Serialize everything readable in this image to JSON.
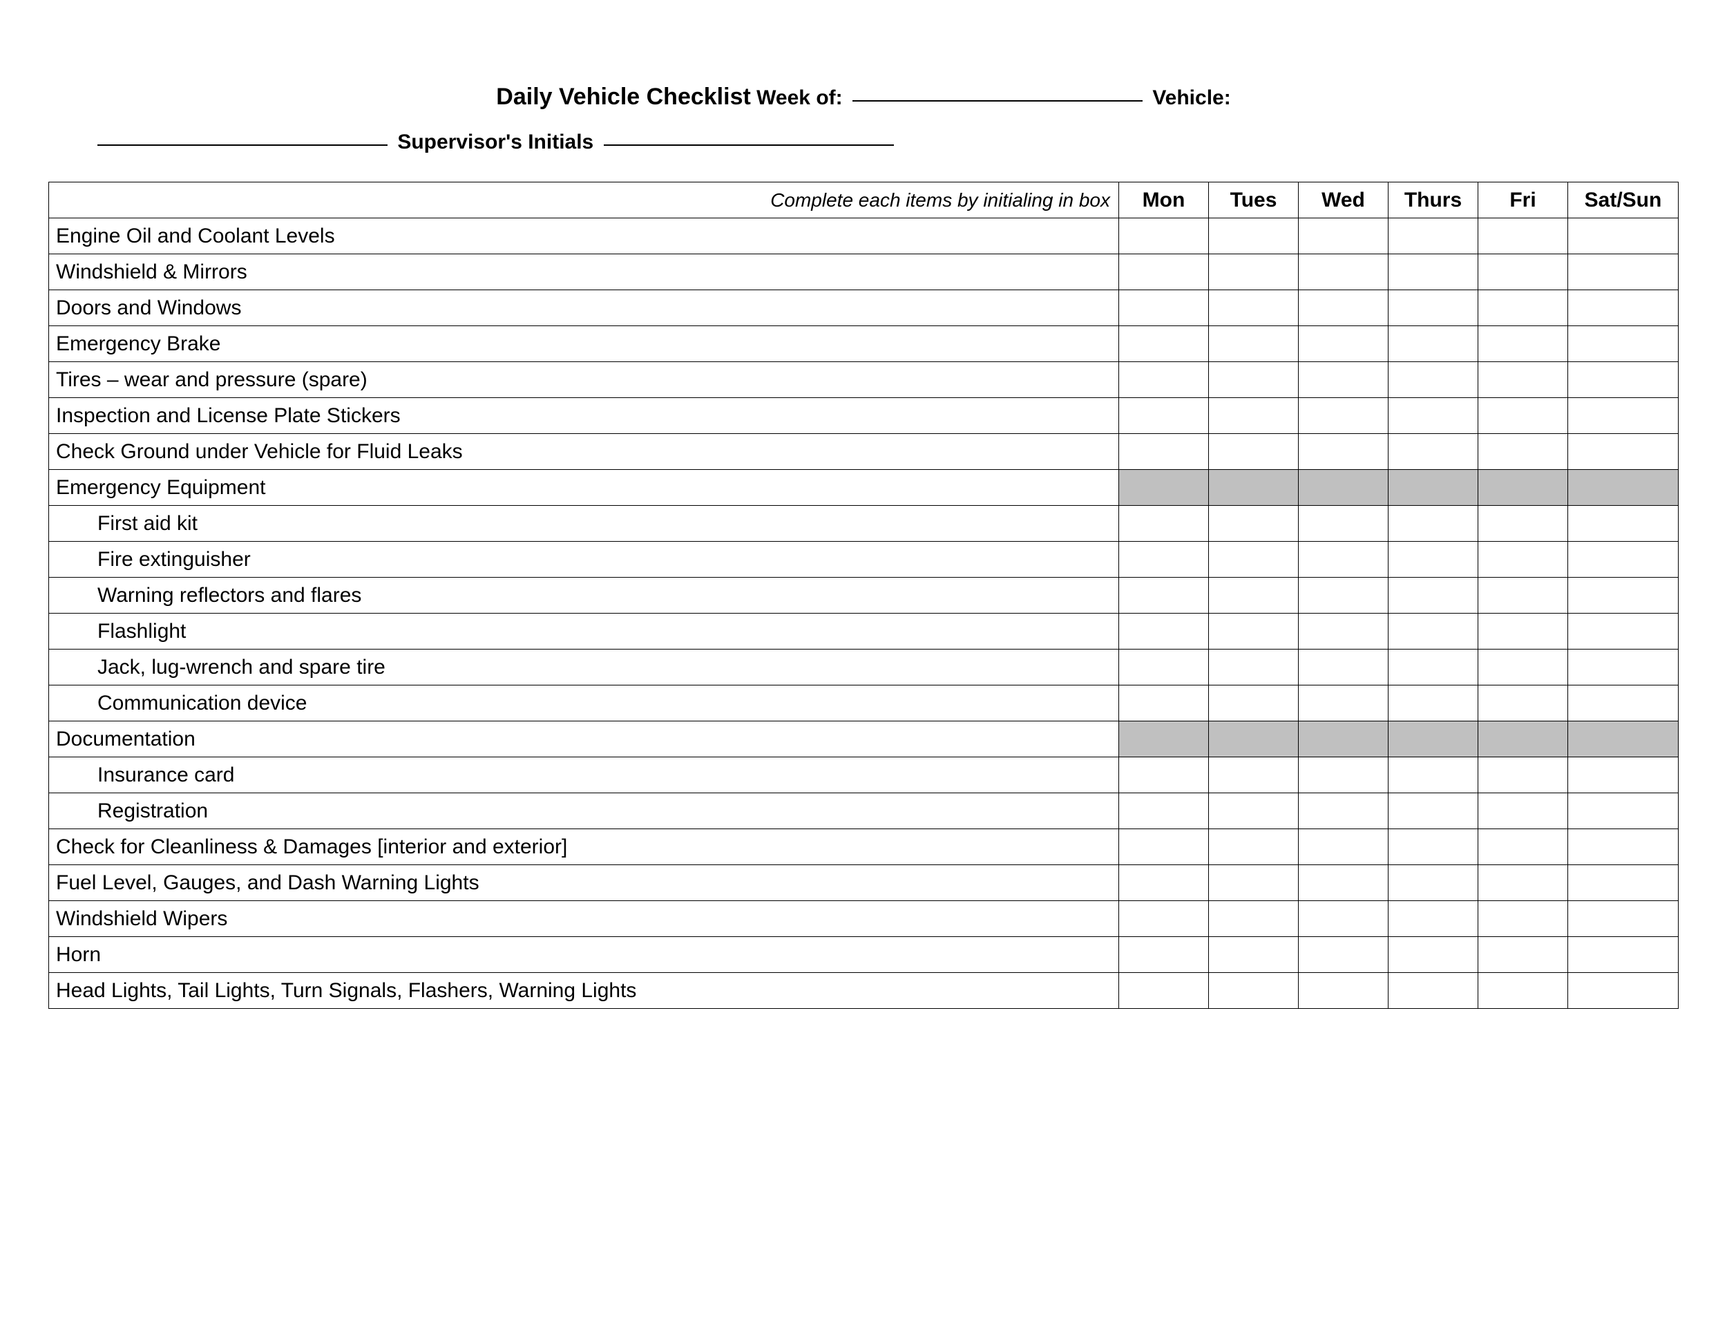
{
  "header": {
    "title": "Daily Vehicle Checklist",
    "week_of_label": "Week of:",
    "vehicle_label": "Vehicle:",
    "supervisor_label": "Supervisor's Initials"
  },
  "table": {
    "instruction": "Complete each items by initialing in box",
    "days": [
      "Mon",
      "Tues",
      "Wed",
      "Thurs",
      "Fri",
      "Sat/Sun"
    ],
    "rows": [
      {
        "label": "Engine Oil and Coolant Levels",
        "indent": false,
        "shaded": false
      },
      {
        "label": "Windshield & Mirrors",
        "indent": false,
        "shaded": false
      },
      {
        "label": "Doors and Windows",
        "indent": false,
        "shaded": false
      },
      {
        "label": "Emergency Brake",
        "indent": false,
        "shaded": false
      },
      {
        "label": "Tires – wear and pressure (spare)",
        "indent": false,
        "shaded": false
      },
      {
        "label": "Inspection and License Plate Stickers",
        "indent": false,
        "shaded": false
      },
      {
        "label": "Check Ground under Vehicle for Fluid Leaks",
        "indent": false,
        "shaded": false
      },
      {
        "label": "Emergency Equipment",
        "indent": false,
        "shaded": true
      },
      {
        "label": "First aid kit",
        "indent": true,
        "shaded": false
      },
      {
        "label": "Fire extinguisher",
        "indent": true,
        "shaded": false
      },
      {
        "label": "Warning reflectors and flares",
        "indent": true,
        "shaded": false
      },
      {
        "label": "Flashlight",
        "indent": true,
        "shaded": false
      },
      {
        "label": "Jack, lug-wrench and spare tire",
        "indent": true,
        "shaded": false
      },
      {
        "label": "Communication device",
        "indent": true,
        "shaded": false
      },
      {
        "label": "Documentation",
        "indent": false,
        "shaded": true
      },
      {
        "label": "Insurance card",
        "indent": true,
        "shaded": false
      },
      {
        "label": "Registration",
        "indent": true,
        "shaded": false
      },
      {
        "label": "Check for Cleanliness & Damages [interior and exterior]",
        "indent": false,
        "shaded": false
      },
      {
        "label": "Fuel Level, Gauges, and Dash Warning Lights",
        "indent": false,
        "shaded": false
      },
      {
        "label": "Windshield Wipers",
        "indent": false,
        "shaded": false
      },
      {
        "label": "Horn",
        "indent": false,
        "shaded": false
      },
      {
        "label": "Head Lights, Tail Lights, Turn Signals, Flashers, Warning Lights",
        "indent": false,
        "shaded": false
      }
    ]
  }
}
